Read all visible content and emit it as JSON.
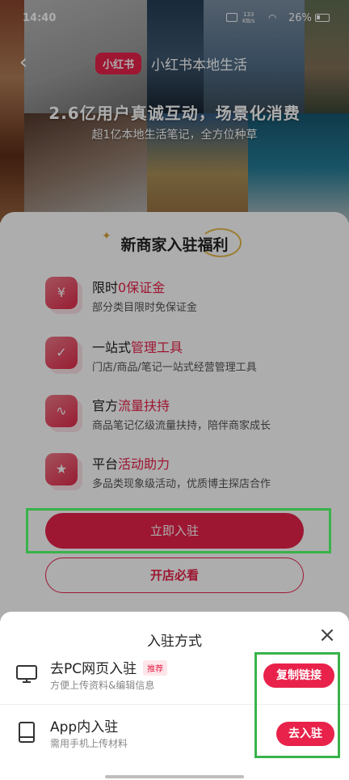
{
  "status_bar": {
    "time": "14:40",
    "net_speed": "133",
    "net_unit": "KB/s",
    "battery": "26%"
  },
  "header": {
    "brand_logo": "小红书",
    "brand_name": "小红书本地生活",
    "headline": "2.6亿用户真诚互动，场景化消费",
    "subline": "超1亿本地生活笔记，全方位种草"
  },
  "card": {
    "title": "新商家入驻福利",
    "benefits": [
      {
        "icon": "yen-icon",
        "title_plain": "限时",
        "title_highlight": "0保证金",
        "desc": "部分类目限时免保证金"
      },
      {
        "icon": "check-icon",
        "title_plain": "一站式",
        "title_highlight": "管理工具",
        "desc": "门店/商品/笔记一站式经营管理工具"
      },
      {
        "icon": "trend-icon",
        "title_plain": "官方",
        "title_highlight": "流量扶持",
        "desc": "商品笔记亿级流量扶持，陪伴商家成长"
      },
      {
        "icon": "star-icon",
        "title_plain": "平台",
        "title_highlight": "活动助力",
        "desc": "多品类现象级活动，优质博主探店合作"
      }
    ],
    "primary_button": "立即入驻",
    "secondary_button": "开店必看"
  },
  "sheet": {
    "title": "入驻方式",
    "options": [
      {
        "name": "去PC网页入驻",
        "tag": "推荐",
        "desc": "方便上传资料&编辑信息",
        "button": "复制链接"
      },
      {
        "name": "App内入驻",
        "tag": "",
        "desc": "需用手机上传材料",
        "button": "去入驻"
      }
    ]
  },
  "colors": {
    "accent": "#e8224a",
    "highlight_frame": "#38b34a"
  }
}
